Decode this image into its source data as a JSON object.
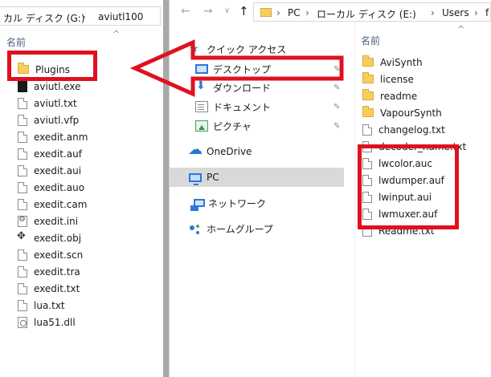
{
  "left_window": {
    "address": {
      "drive": "カル ディスク (G:)",
      "folder": "aviutl100"
    },
    "column_header": "名前",
    "files": [
      {
        "name": "Plugins",
        "icon": "folder-icon"
      },
      {
        "name": "aviutl.exe",
        "icon": "exe-icon"
      },
      {
        "name": "aviutl.txt",
        "icon": "text-file-icon"
      },
      {
        "name": "aviutl.vfp",
        "icon": "file-icon"
      },
      {
        "name": "exedit.anm",
        "icon": "file-icon"
      },
      {
        "name": "exedit.auf",
        "icon": "file-icon"
      },
      {
        "name": "exedit.aui",
        "icon": "file-icon"
      },
      {
        "name": "exedit.auo",
        "icon": "file-icon"
      },
      {
        "name": "exedit.cam",
        "icon": "file-icon"
      },
      {
        "name": "exedit.ini",
        "icon": "settings-file-icon"
      },
      {
        "name": "exedit.obj",
        "icon": "object-file-icon"
      },
      {
        "name": "exedit.scn",
        "icon": "file-icon"
      },
      {
        "name": "exedit.tra",
        "icon": "file-icon"
      },
      {
        "name": "exedit.txt",
        "icon": "text-file-icon"
      },
      {
        "name": "lua.txt",
        "icon": "text-file-icon"
      },
      {
        "name": "lua51.dll",
        "icon": "dll-file-icon"
      }
    ]
  },
  "right_window": {
    "address": {
      "crumbs": [
        "PC",
        "ローカル ディスク (E:)",
        "Users",
        "f"
      ]
    },
    "nav_pane": {
      "quick_access": "クイック アクセス",
      "items": [
        {
          "label": "デスクトップ",
          "icon": "desktop-icon",
          "pinned": true
        },
        {
          "label": "ダウンロード",
          "icon": "download-icon",
          "pinned": true
        },
        {
          "label": "ドキュメント",
          "icon": "documents-icon",
          "pinned": true
        },
        {
          "label": "ピクチャ",
          "icon": "pictures-icon",
          "pinned": true
        }
      ],
      "onedrive": "OneDrive",
      "pc": "PC",
      "network": "ネットワーク",
      "homegroup": "ホームグループ"
    },
    "column_header": "名前",
    "files": [
      {
        "name": "AviSynth",
        "icon": "folder-icon"
      },
      {
        "name": "license",
        "icon": "folder-icon"
      },
      {
        "name": "readme",
        "icon": "folder-icon"
      },
      {
        "name": "VapourSynth",
        "icon": "folder-icon"
      },
      {
        "name": "changelog.txt",
        "icon": "text-file-icon"
      },
      {
        "name": "decoder_name.txt",
        "icon": "text-file-icon"
      },
      {
        "name": "lwcolor.auc",
        "icon": "file-icon"
      },
      {
        "name": "lwdumper.auf",
        "icon": "file-icon"
      },
      {
        "name": "lwinput.aui",
        "icon": "file-icon"
      },
      {
        "name": "lwmuxer.auf",
        "icon": "file-icon"
      },
      {
        "name": "Readme.txt",
        "icon": "text-file-icon"
      }
    ]
  },
  "colors": {
    "annotation_red": "#e0101f",
    "selection_gray": "#d9d9d9",
    "accent_blue": "#2b79d8"
  }
}
